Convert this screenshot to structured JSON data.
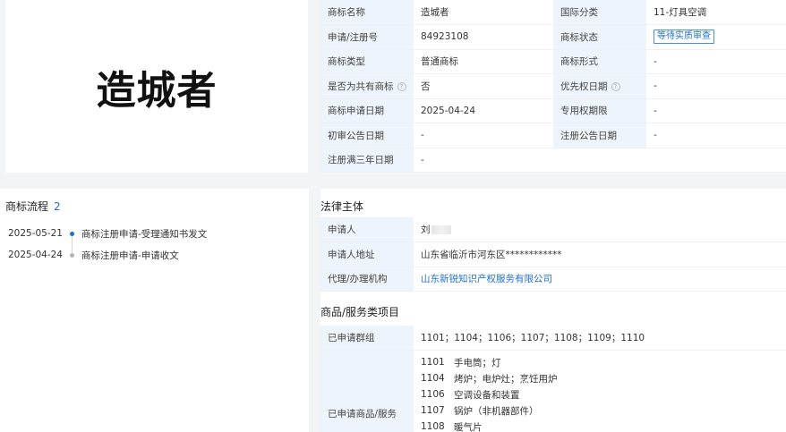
{
  "trademark_image": {
    "text": "造城者"
  },
  "info": {
    "rows": [
      {
        "k1": "商标名称",
        "v1": "造城者",
        "k2": "国际分类",
        "v2": "11-灯具空调"
      },
      {
        "k1": "申请/注册号",
        "v1": "84923108",
        "k2": "商标状态",
        "v2": "等待实质审查"
      },
      {
        "k1": "商标类型",
        "v1": "普通商标",
        "k2": "商标形式",
        "v2": "-"
      },
      {
        "k1": "是否为共有商标",
        "v1": "否",
        "k2": "优先权日期",
        "v2": "-"
      },
      {
        "k1": "商标申请日期",
        "v1": "2025-04-24",
        "k2": "专用权期限",
        "v2": "-"
      },
      {
        "k1": "初审公告日期",
        "v1": "-",
        "k2": "注册公告日期",
        "v2": "-"
      },
      {
        "k1": "注册满三年日期",
        "v1": "-"
      }
    ],
    "help_glyph": "?"
  },
  "flow": {
    "title": "商标流程",
    "count": "2",
    "items": [
      {
        "date": "2025-05-21",
        "text": "商标注册申请-受理通知书发文",
        "color": "#1f6fd1"
      },
      {
        "date": "2025-04-24",
        "text": "商标注册申请-申请收文",
        "color": "#b5b5b5"
      }
    ]
  },
  "legal": {
    "title": "法律主体",
    "applicant_label": "申请人",
    "applicant_value": "刘",
    "address_label": "申请人地址",
    "address_value": "山东省临沂市河东区************",
    "agent_label": "代理/办理机构",
    "agent_value": "山东新锐知识产权服务有限公司"
  },
  "goods": {
    "title": "商品/服务类项目",
    "groups_label": "已申请群组",
    "groups_value": "1101；1104；1106；1107；1108；1109；1110",
    "goods_label": "已申请商品/服务",
    "items": [
      {
        "code": "1101",
        "name": "手电筒；灯"
      },
      {
        "code": "1104",
        "name": "烤炉；电炉灶；烹饪用炉"
      },
      {
        "code": "1106",
        "name": "空调设备和装置"
      },
      {
        "code": "1107",
        "name": "锅炉（非机器部件）"
      },
      {
        "code": "1108",
        "name": "暖气片"
      }
    ]
  }
}
